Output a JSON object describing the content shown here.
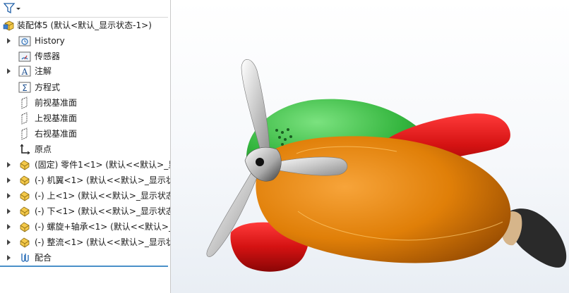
{
  "tree": {
    "root_label": "装配体5  (默认<默认_显示状态-1>)",
    "items": [
      {
        "label": "History"
      },
      {
        "label": "传感器"
      },
      {
        "label": "注解"
      },
      {
        "label": "方程式"
      },
      {
        "label": "前视基准面"
      },
      {
        "label": "上视基准面"
      },
      {
        "label": "右视基准面"
      },
      {
        "label": "原点"
      },
      {
        "label": "(固定) 零件1<1> (默认<<默认>_显"
      },
      {
        "label": "(-) 机翼<1> (默认<<默认>_显示状"
      },
      {
        "label": "(-) 上<1> (默认<<默认>_显示状态"
      },
      {
        "label": "(-) 下<1> (默认<<默认>_显示状态"
      },
      {
        "label": "(-) 螺旋+轴承<1> (默认<<默认>_显"
      },
      {
        "label": "(-) 整流<1> (默认<<默认>_显示状"
      },
      {
        "label": "配合"
      }
    ]
  },
  "model": {
    "body_color": "#e8860c",
    "canopy_color": "#3fc24a",
    "wing_color": "#d81414",
    "propeller_color": "#d0d0d0",
    "exhaust_color": "#2a2a2a"
  }
}
